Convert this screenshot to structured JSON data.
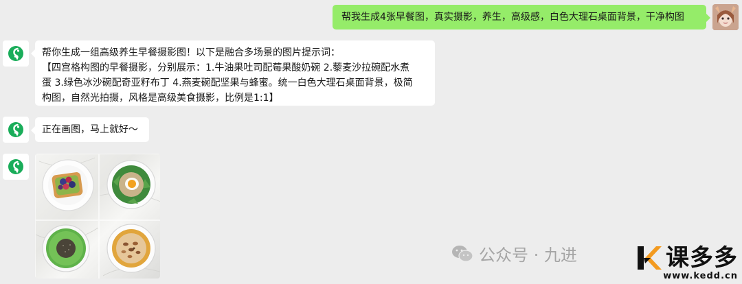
{
  "messages": {
    "user_prompt": "帮我生成4张早餐图，真实摄影，养生，高级感，白色大理石桌面背景，干净构图",
    "bot_reply_lines": [
      "帮你生成一组高级养生早餐摄影图！以下是融合多场景的图片提示词：",
      "【四宫格构图的早餐摄影，分别展示：1.牛油果吐司配莓果酸奶碗 2.藜麦沙拉碗配水煮",
      "蛋 3.绿色冰沙碗配奇亚籽布丁 4.燕麦碗配坚果与蜂蜜。统一白色大理石桌面背景，极简",
      "构图，自然光拍摄，风格是高级美食摄影，比例是1:1】"
    ],
    "bot_status": "正在画图，马上就好～"
  },
  "generated_image": {
    "cells": [
      "牛油果吐司配莓果酸奶碗",
      "藜麦沙拉碗配水煮蛋",
      "绿色冰沙碗配奇亚籽布丁",
      "燕麦碗配坚果与蜂蜜"
    ]
  },
  "watermark": {
    "text": "公众号 · 九进",
    "icon": "wechat-icon"
  },
  "brand": {
    "name": "课多多",
    "url": "www.kedd.cn"
  },
  "colors": {
    "background": "#ededed",
    "user_bubble": "#95ec69",
    "bot_bubble": "#ffffff",
    "bot_logo": "#1aad5a"
  }
}
